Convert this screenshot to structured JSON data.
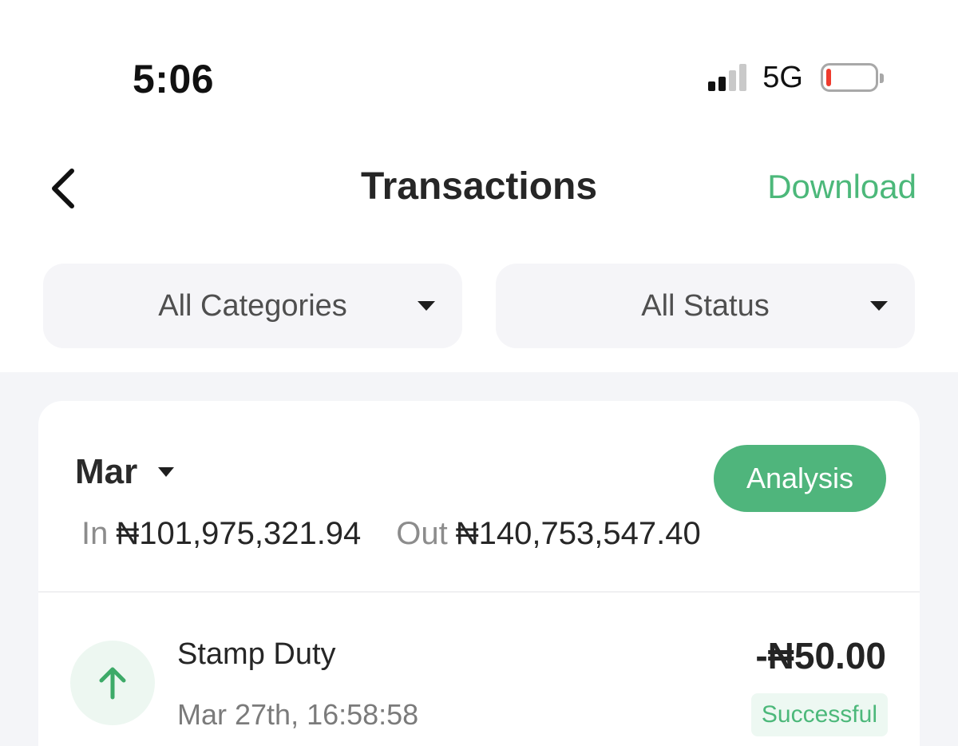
{
  "status_bar": {
    "time": "5:06",
    "network": "5G",
    "signal_bars_active": 2,
    "signal_bars_total": 4,
    "battery_level": 0.1,
    "battery_color": "#ef3b2d"
  },
  "header": {
    "title": "Transactions",
    "download_label": "Download",
    "accent_color": "#4cb87a"
  },
  "filters": {
    "categories": "All Categories",
    "status": "All Status"
  },
  "summary": {
    "month": "Mar",
    "analysis_label": "Analysis",
    "in_label": "In",
    "in_value": "₦101,975,321.94",
    "out_label": "Out",
    "out_value": "₦140,753,547.40"
  },
  "transactions": [
    {
      "title": "Stamp Duty",
      "date": "Mar 27th, 16:58:58",
      "amount": "-₦50.00",
      "status": "Successful",
      "icon": "arrow-up-icon"
    }
  ]
}
